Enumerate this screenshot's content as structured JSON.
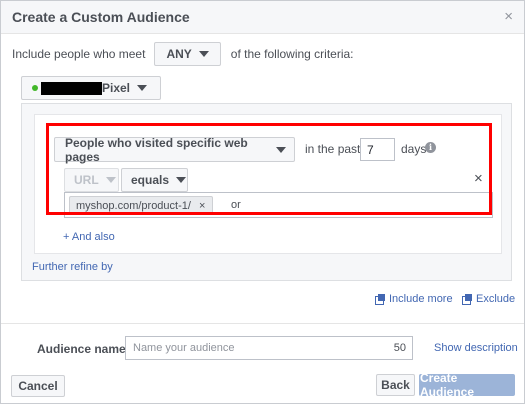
{
  "dialog": {
    "title": "Create a Custom Audience",
    "close_glyph": "×"
  },
  "criteria": {
    "prefix": "Include people who meet",
    "match_value": "ANY",
    "suffix": "of the following criteria:"
  },
  "pixel": {
    "label": "Pixel",
    "status_color": "#42b72a"
  },
  "rule": {
    "event_label": "People who visited specific web pages",
    "in_the_past": "in the past",
    "days_value": "7",
    "days_label": "days",
    "info_glyph": "i",
    "field_label": "URL",
    "operator_label": "equals",
    "remove_glyph": "×",
    "url_token": "myshop.com/product-1/",
    "token_remove_glyph": "×",
    "or_label": "or",
    "and_also": "+ And also"
  },
  "further_refine": "Further refine by",
  "actions": {
    "include_more": "Include more",
    "exclude": "Exclude"
  },
  "audience": {
    "label": "Audience name",
    "placeholder": "Name your audience",
    "char_limit": "50",
    "show_description": "Show description"
  },
  "footer": {
    "cancel": "Cancel",
    "back": "Back",
    "create": "Create Audience"
  },
  "colors": {
    "highlight_box": "#ff0000",
    "link": "#4267b2",
    "primary_disabled": "#9cb4d8"
  }
}
